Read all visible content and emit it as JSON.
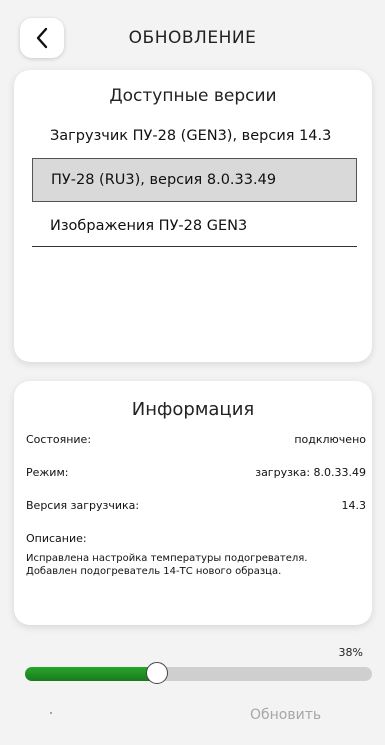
{
  "header": {
    "title": "ОБНОВЛЕНИЕ"
  },
  "versions": {
    "heading": "Доступные версии",
    "items": [
      {
        "label": "Загрузчик ПУ-28 (GEN3), версия 14.3",
        "selected": false
      },
      {
        "label": "ПУ-28 (RU3), версия 8.0.33.49",
        "selected": true
      },
      {
        "label": "Изображения ПУ-28 GEN3",
        "selected": false
      }
    ]
  },
  "info": {
    "heading": "Информация",
    "rows": [
      {
        "label": "Состояние:",
        "value": "подключено"
      },
      {
        "label": "Режим:",
        "value": "загрузка: 8.0.33.49"
      },
      {
        "label": "Версия загрузчика:",
        "value": "14.3"
      }
    ],
    "description_label": "Описание:",
    "description": "Исправлена настройка температуры подогревателя.\nДобавлен подогреватель 14-ТС нового образца."
  },
  "progress": {
    "percent_label": "38%",
    "fraction": 0.38,
    "fill_color": "#1f8f22"
  },
  "actions": {
    "update_label": "Обновить"
  }
}
